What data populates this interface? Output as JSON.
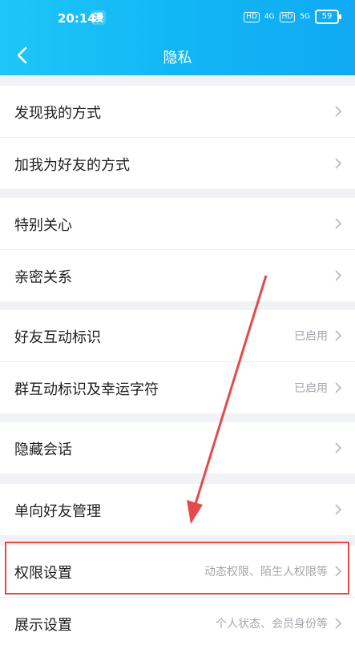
{
  "status_bar": {
    "time": "20:14",
    "app_badge": "漫",
    "network1": "HD",
    "signal1": "4G",
    "network2": "HD",
    "signal2": "5G",
    "battery": "59"
  },
  "nav": {
    "title": "隐私",
    "back_icon": "chevron-left-icon"
  },
  "groups": [
    {
      "items": [
        {
          "label": "发现我的方式",
          "value": ""
        },
        {
          "label": "加我为好友的方式",
          "value": ""
        }
      ]
    },
    {
      "items": [
        {
          "label": "特别关心",
          "value": ""
        },
        {
          "label": "亲密关系",
          "value": ""
        }
      ]
    },
    {
      "items": [
        {
          "label": "好友互动标识",
          "value": "已启用"
        },
        {
          "label": "群互动标识及幸运字符",
          "value": "已启用"
        }
      ]
    },
    {
      "items": [
        {
          "label": "隐藏会话",
          "value": ""
        }
      ]
    },
    {
      "items": [
        {
          "label": "单向好友管理",
          "value": ""
        }
      ]
    },
    {
      "items": [
        {
          "label": "权限设置",
          "value": "动态权限、陌生人权限等"
        },
        {
          "label": "展示设置",
          "value": "个人状态、会员身份等"
        }
      ]
    }
  ],
  "colors": {
    "accent": "#12b6f5",
    "highlight": "#e44a4a",
    "background": "#f1f2f6"
  }
}
